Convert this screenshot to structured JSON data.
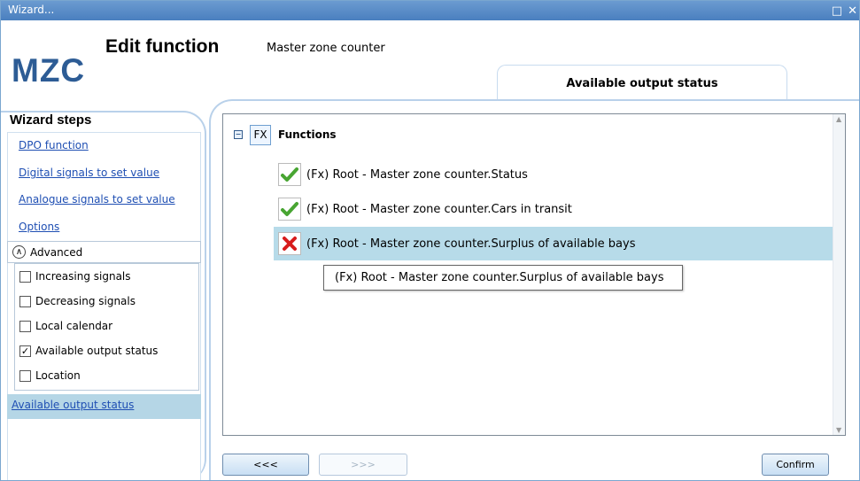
{
  "window": {
    "title": "Wizard...",
    "controls": [
      "□",
      "✕"
    ]
  },
  "header": {
    "badge": "MZC",
    "title": "Edit function",
    "function_name": "Master zone counter",
    "active_tab": "Available output status"
  },
  "sidebar": {
    "title": "Wizard steps",
    "steps": [
      "DPO function",
      "Digital signals to set value",
      "Analogue signals to set value",
      "Options"
    ],
    "advanced": {
      "label": "Advanced",
      "icon": "chevron-up-icon",
      "options": [
        {
          "label": "Increasing signals",
          "checked": false
        },
        {
          "label": "Decreasing signals",
          "checked": false
        },
        {
          "label": "Local calendar",
          "checked": false
        },
        {
          "label": "Available output status",
          "checked": true
        },
        {
          "label": "Location",
          "checked": false
        }
      ]
    },
    "selected_step": "Available output status"
  },
  "tree": {
    "root": {
      "label": "Functions",
      "icon": "fx-icon",
      "icon_text": "FX"
    },
    "items": [
      {
        "label": "(Fx) Root - Master zone counter.Status",
        "status": "check-icon"
      },
      {
        "label": "(Fx) Root - Master zone counter.Cars in transit",
        "status": "check-icon"
      },
      {
        "label": "(Fx) Root - Master zone counter.Surplus of available bays",
        "status": "cross-icon"
      }
    ],
    "tooltip": "(Fx) Root - Master zone counter.Surplus of available bays"
  },
  "buttons": {
    "back": "<<<",
    "next": ">>>",
    "confirm": "Confirm"
  },
  "colors": {
    "title_bar": "#4a7fbf",
    "accent_blue": "#2d5c95",
    "selection": "#b7dbe9",
    "link": "#1f4fb3",
    "success": "#48a532",
    "error": "#d71b1b"
  }
}
